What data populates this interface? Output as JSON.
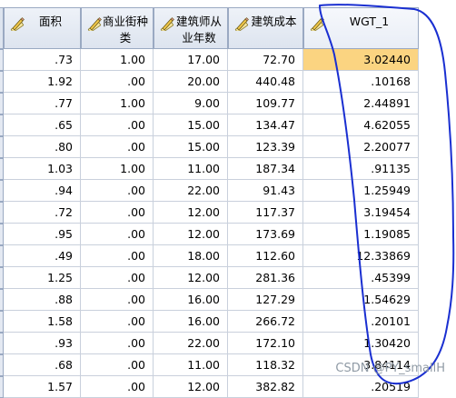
{
  "columns": [
    {
      "id": "mianji",
      "label": "面积"
    },
    {
      "id": "shangye",
      "label": "商业街种\n类"
    },
    {
      "id": "nianshu",
      "label": "建筑师从\n业年数"
    },
    {
      "id": "chengben",
      "label": "建筑成本"
    },
    {
      "id": "wgt",
      "label": "WGT_1"
    }
  ],
  "rows": [
    [
      ".73",
      "1.00",
      "17.00",
      "72.70",
      "3.02440"
    ],
    [
      "1.92",
      ".00",
      "20.00",
      "440.48",
      ".10168"
    ],
    [
      ".77",
      "1.00",
      "9.00",
      "109.77",
      "2.44891"
    ],
    [
      ".65",
      ".00",
      "15.00",
      "134.47",
      "4.62055"
    ],
    [
      ".80",
      ".00",
      "15.00",
      "123.39",
      "2.20077"
    ],
    [
      "1.03",
      "1.00",
      "11.00",
      "187.34",
      ".91135"
    ],
    [
      ".94",
      ".00",
      "22.00",
      "91.43",
      "1.25949"
    ],
    [
      ".72",
      ".00",
      "12.00",
      "117.37",
      "3.19454"
    ],
    [
      ".95",
      ".00",
      "12.00",
      "173.69",
      "1.19085"
    ],
    [
      ".49",
      ".00",
      "18.00",
      "112.60",
      "12.33869"
    ],
    [
      "1.25",
      ".00",
      "12.00",
      "281.36",
      ".45399"
    ],
    [
      ".88",
      ".00",
      "16.00",
      "127.29",
      "1.54629"
    ],
    [
      "1.58",
      ".00",
      "16.00",
      "266.72",
      ".20101"
    ],
    [
      ".93",
      ".00",
      "22.00",
      "172.10",
      "1.30420"
    ],
    [
      ".68",
      ".00",
      "11.00",
      "118.32",
      "3.84114"
    ],
    [
      "1.57",
      ".00",
      "12.00",
      "382.82",
      ".20519"
    ]
  ],
  "highlighted_cell": {
    "row": 0,
    "column": "wgt"
  },
  "watermark": "CSDN @PY_smallH",
  "colors": {
    "header_bg": "#dde4ef",
    "header_border": "#9aa9c2",
    "grid_line": "#c9d0dc",
    "highlight": "#fbd481",
    "annotation_ink": "#1a2fd1",
    "pencil_yellow": "#f2c84a"
  },
  "icons": {
    "column_type": "pencil-ruler-icon"
  }
}
